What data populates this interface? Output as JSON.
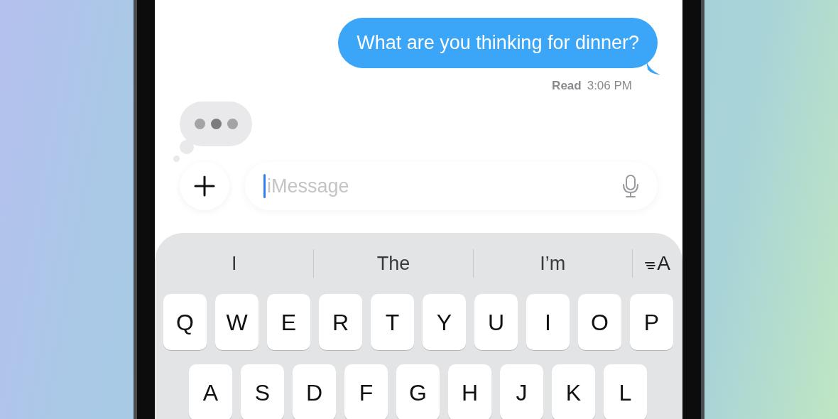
{
  "message": {
    "text": "What are you thinking for dinner?",
    "status": "Read",
    "time": "3:06 PM"
  },
  "typing": true,
  "composer": {
    "placeholder": "iMessage",
    "focused": true
  },
  "suggestions": [
    "I",
    "The",
    "I’m"
  ],
  "format_key": "A",
  "keyboard_rows": [
    [
      "Q",
      "W",
      "E",
      "R",
      "T",
      "Y",
      "U",
      "I",
      "O",
      "P"
    ],
    [
      "A",
      "S",
      "D",
      "F",
      "G",
      "H",
      "J",
      "K",
      "L"
    ]
  ]
}
